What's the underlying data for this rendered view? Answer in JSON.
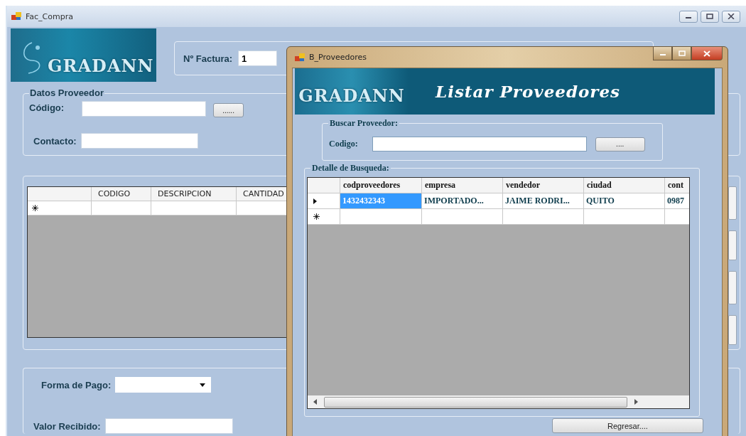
{
  "main_window": {
    "title": "Fac_Compra",
    "logo": "GRADANN",
    "invoice": {
      "label": "Nº Factura:",
      "value": "1"
    },
    "supplier": {
      "title": "Datos Proveedor",
      "code_label": "Código:",
      "browse_button": "......",
      "contact_label": "Contacto:"
    },
    "items_table": {
      "columns": [
        "CODIGO",
        "DESCRIPCION",
        "CANTIDAD"
      ]
    },
    "payment": {
      "method_label": "Forma de Pago:",
      "received_label": "Valor Recibido:"
    }
  },
  "dialog": {
    "title": "B_Proveedores",
    "logo": "GRADANN",
    "heading": "Listar Proveedores",
    "search": {
      "title": "Buscar Proveedor:",
      "label": "Codigo:",
      "button": "...."
    },
    "results": {
      "title": "Detalle de Busqueda:",
      "columns": [
        "codproveedores",
        "empresa",
        "vendedor",
        "ciudad",
        "cont"
      ],
      "rows": [
        {
          "current": true,
          "cells": [
            {
              "text": "1432432343",
              "selected": true
            },
            {
              "text": "IMPORTADO...",
              "selected": false
            },
            {
              "text": "JAIME RODRI...",
              "selected": false
            },
            {
              "text": "QUITO",
              "selected": false
            },
            {
              "text": "0987",
              "selected": false
            }
          ]
        }
      ]
    },
    "back_button": "Regresar...."
  }
}
